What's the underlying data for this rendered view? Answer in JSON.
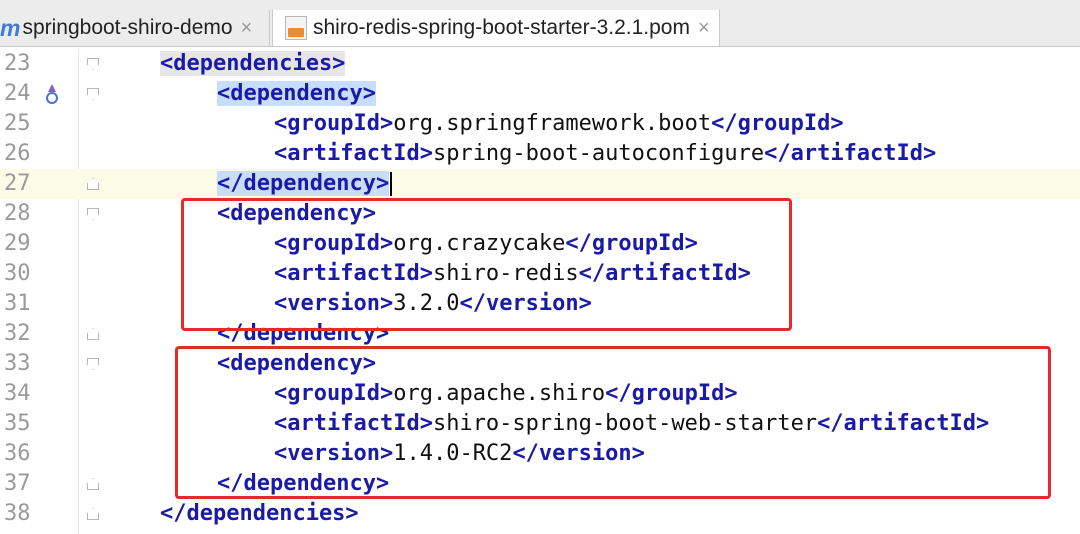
{
  "tabs": [
    {
      "icon": "maven-m-icon",
      "icon_text": "m",
      "label": "springboot-shiro-demo",
      "close": "×"
    },
    {
      "icon": "pom-file-icon",
      "label": "shiro-redis-spring-boot-starter-3.2.1.pom",
      "close": "×"
    }
  ],
  "lines": [
    {
      "num": "23",
      "indent": 0,
      "open": "dependencies",
      "text": "",
      "close": ""
    },
    {
      "num": "24",
      "indent": 1,
      "open": "dependency",
      "text": "",
      "close": ""
    },
    {
      "num": "25",
      "indent": 2,
      "open": "groupId",
      "text": "org.springframework.boot",
      "close": "groupId"
    },
    {
      "num": "26",
      "indent": 2,
      "open": "artifactId",
      "text": "spring-boot-autoconfigure",
      "close": "artifactId"
    },
    {
      "num": "27",
      "indent": 1,
      "open": "",
      "text": "",
      "close": "dependency"
    },
    {
      "num": "28",
      "indent": 1,
      "open": "dependency",
      "text": "",
      "close": ""
    },
    {
      "num": "29",
      "indent": 2,
      "open": "groupId",
      "text": "org.crazycake",
      "close": "groupId"
    },
    {
      "num": "30",
      "indent": 2,
      "open": "artifactId",
      "text": "shiro-redis",
      "close": "artifactId"
    },
    {
      "num": "31",
      "indent": 2,
      "open": "version",
      "text": "3.2.0",
      "close": "version"
    },
    {
      "num": "32",
      "indent": 1,
      "open": "",
      "text": "",
      "close": "dependency"
    },
    {
      "num": "33",
      "indent": 1,
      "open": "dependency",
      "text": "",
      "close": ""
    },
    {
      "num": "34",
      "indent": 2,
      "open": "groupId",
      "text": "org.apache.shiro",
      "close": "groupId"
    },
    {
      "num": "35",
      "indent": 2,
      "open": "artifactId",
      "text": "shiro-spring-boot-web-starter",
      "close": "artifactId"
    },
    {
      "num": "36",
      "indent": 2,
      "open": "version",
      "text": "1.4.0-RC2",
      "close": "version"
    },
    {
      "num": "37",
      "indent": 1,
      "open": "",
      "text": "",
      "close": "dependency"
    },
    {
      "num": "38",
      "indent": 0,
      "open": "",
      "text": "",
      "close": "dependencies"
    }
  ],
  "colors": {
    "tag": "#1a1aa6",
    "highlight": "#e42a2a",
    "line_number": "#9a9a9a"
  }
}
